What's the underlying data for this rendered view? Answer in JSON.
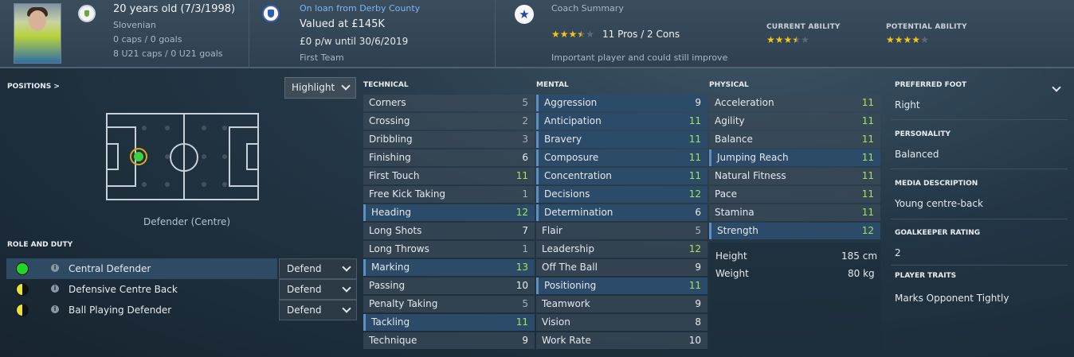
{
  "header": {
    "age": "20 years old (7/3/1998)",
    "nationality": "Slovenian",
    "caps": "0 caps / 0 goals",
    "u21_caps": "8 U21 caps / 0 U21 goals",
    "loan_link": "On loan from Derby County",
    "value": "Valued at £145K",
    "wage": "£0 p/w until 30/6/2019",
    "squad_status": "First Team",
    "coach_summary_label": "Coach Summary",
    "pros_cons": "11 Pros / 2 Cons",
    "coach_note": "Important player and could still improve",
    "coach_stars": 3.5,
    "current_ability_label": "CURRENT ABILITY",
    "current_ability_stars": 3.5,
    "potential_ability_label": "POTENTIAL ABILITY",
    "potential_ability_stars": 4,
    "star_color": "#f5c518"
  },
  "positions": {
    "title": "POSITIONS >",
    "highlight_label": "Highlight",
    "position_label": "Defender (Centre)",
    "marker_color": "#3fd13f"
  },
  "role_duty": {
    "title": "ROLE AND DUTY",
    "roles": [
      {
        "name": "Central Defender",
        "duty": "Defend",
        "suitability": "green"
      },
      {
        "name": "Defensive Centre Back",
        "duty": "Defend",
        "suitability": "half"
      },
      {
        "name": "Ball Playing Defender",
        "duty": "Defend",
        "suitability": "half"
      }
    ]
  },
  "technical": {
    "title": "TECHNICAL",
    "attributes": [
      {
        "name": "Corners",
        "value": "5",
        "hl": false
      },
      {
        "name": "Crossing",
        "value": "2",
        "hl": false
      },
      {
        "name": "Dribbling",
        "value": "3",
        "hl": false
      },
      {
        "name": "Finishing",
        "value": "6",
        "hl": false
      },
      {
        "name": "First Touch",
        "value": "11",
        "hl": false
      },
      {
        "name": "Free Kick Taking",
        "value": "1",
        "hl": false
      },
      {
        "name": "Heading",
        "value": "12",
        "hl": true
      },
      {
        "name": "Long Shots",
        "value": "7",
        "hl": false
      },
      {
        "name": "Long Throws",
        "value": "1",
        "hl": false
      },
      {
        "name": "Marking",
        "value": "13",
        "hl": true
      },
      {
        "name": "Passing",
        "value": "10",
        "hl": false
      },
      {
        "name": "Penalty Taking",
        "value": "5",
        "hl": false
      },
      {
        "name": "Tackling",
        "value": "11",
        "hl": true
      },
      {
        "name": "Technique",
        "value": "9",
        "hl": false
      }
    ]
  },
  "mental": {
    "title": "MENTAL",
    "attributes": [
      {
        "name": "Aggression",
        "value": "9",
        "hl": true
      },
      {
        "name": "Anticipation",
        "value": "11",
        "hl": true
      },
      {
        "name": "Bravery",
        "value": "11",
        "hl": true
      },
      {
        "name": "Composure",
        "value": "11",
        "hl": true
      },
      {
        "name": "Concentration",
        "value": "11",
        "hl": true
      },
      {
        "name": "Decisions",
        "value": "12",
        "hl": true
      },
      {
        "name": "Determination",
        "value": "6",
        "hl": true
      },
      {
        "name": "Flair",
        "value": "5",
        "hl": false
      },
      {
        "name": "Leadership",
        "value": "12",
        "hl": false
      },
      {
        "name": "Off The Ball",
        "value": "9",
        "hl": false
      },
      {
        "name": "Positioning",
        "value": "11",
        "hl": true
      },
      {
        "name": "Teamwork",
        "value": "9",
        "hl": false
      },
      {
        "name": "Vision",
        "value": "8",
        "hl": false
      },
      {
        "name": "Work Rate",
        "value": "10",
        "hl": false
      }
    ]
  },
  "physical": {
    "title": "PHYSICAL",
    "attributes": [
      {
        "name": "Acceleration",
        "value": "11",
        "hl": false
      },
      {
        "name": "Agility",
        "value": "11",
        "hl": false
      },
      {
        "name": "Balance",
        "value": "11",
        "hl": false
      },
      {
        "name": "Jumping Reach",
        "value": "11",
        "hl": true
      },
      {
        "name": "Natural Fitness",
        "value": "11",
        "hl": false
      },
      {
        "name": "Pace",
        "value": "11",
        "hl": false
      },
      {
        "name": "Stamina",
        "value": "11",
        "hl": false
      },
      {
        "name": "Strength",
        "value": "12",
        "hl": true
      }
    ],
    "height_label": "Height",
    "height_value": "185 cm",
    "weight_label": "Weight",
    "weight_value": "80 kg"
  },
  "info": {
    "preferred_foot_label": "PREFERRED FOOT",
    "preferred_foot": "Right",
    "personality_label": "PERSONALITY",
    "personality": "Balanced",
    "media_label": "MEDIA DESCRIPTION",
    "media": "Young centre-back",
    "gk_label": "GOALKEEPER RATING",
    "gk": "2",
    "traits_label": "PLAYER TRAITS",
    "traits": "Marks Opponent Tightly"
  }
}
